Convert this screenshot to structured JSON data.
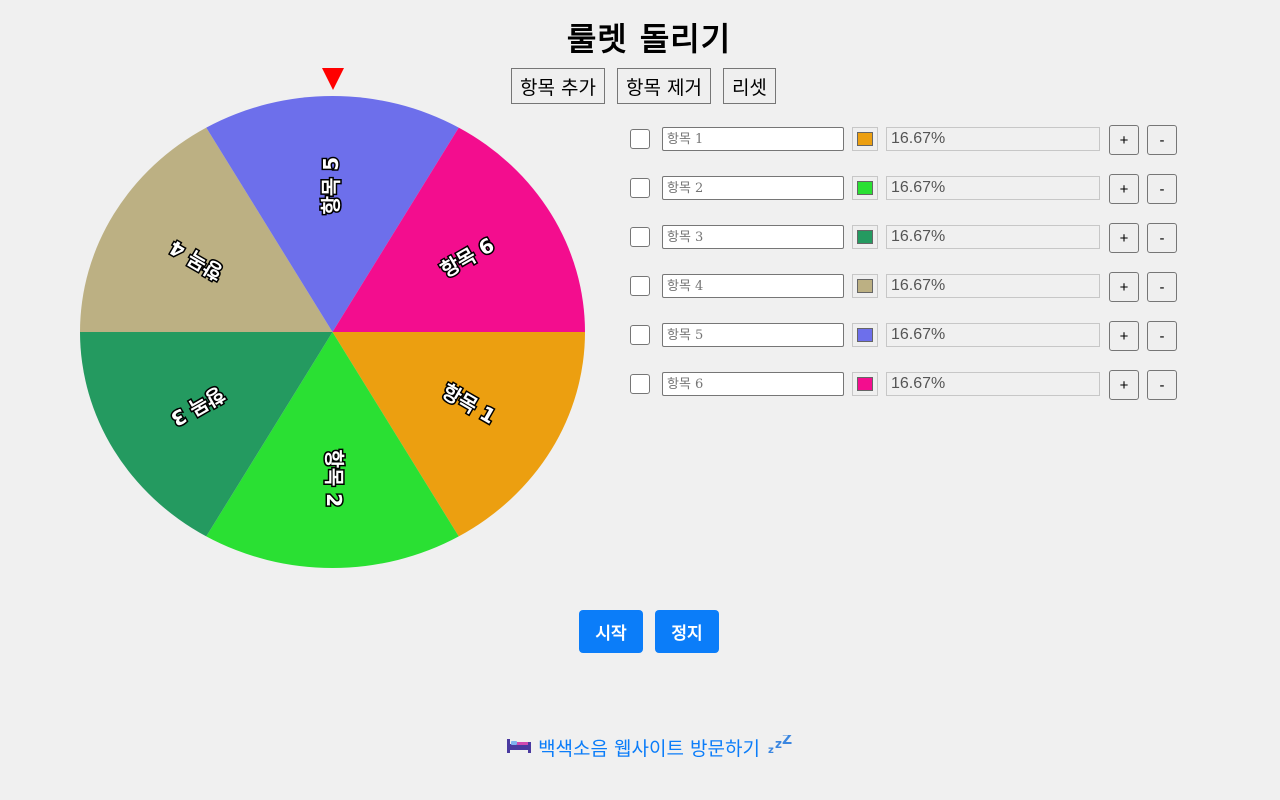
{
  "title": "룰렛 돌리기",
  "toolbar": {
    "add_label": "항목 추가",
    "remove_label": "항목 제거",
    "reset_label": "리셋"
  },
  "wheel": {
    "segments": [
      {
        "label": "항목 1",
        "color": "#EC9F10"
      },
      {
        "label": "항목 2",
        "color": "#2AE033"
      },
      {
        "label": "항목 3",
        "color": "#249A60"
      },
      {
        "label": "항목 4",
        "color": "#BCB083"
      },
      {
        "label": "항목 5",
        "color": "#6D6FEB"
      },
      {
        "label": "항목 6",
        "color": "#F30D8E"
      }
    ],
    "pointer_color": "#FF0000"
  },
  "items": [
    {
      "placeholder": "항목 1",
      "color": "#EC9F10",
      "percent": "16.67%",
      "plus": "+",
      "minus": "-"
    },
    {
      "placeholder": "항목 2",
      "color": "#2AE033",
      "percent": "16.67%",
      "plus": "+",
      "minus": "-"
    },
    {
      "placeholder": "항목 3",
      "color": "#249A60",
      "percent": "16.67%",
      "plus": "+",
      "minus": "-"
    },
    {
      "placeholder": "항목 4",
      "color": "#BCB083",
      "percent": "16.67%",
      "plus": "+",
      "minus": "-"
    },
    {
      "placeholder": "항목 5",
      "color": "#6D6FEB",
      "percent": "16.67%",
      "plus": "+",
      "minus": "-"
    },
    {
      "placeholder": "항목 6",
      "color": "#F30D8E",
      "percent": "16.67%",
      "plus": "+",
      "minus": "-"
    }
  ],
  "controls": {
    "start_label": "시작",
    "stop_label": "정지",
    "accent": "#0B7DF9"
  },
  "footer": {
    "link_text": "백색소음 웹사이트 방문하기",
    "left_icon": "bed-icon",
    "right_icon": "zzz-icon"
  }
}
